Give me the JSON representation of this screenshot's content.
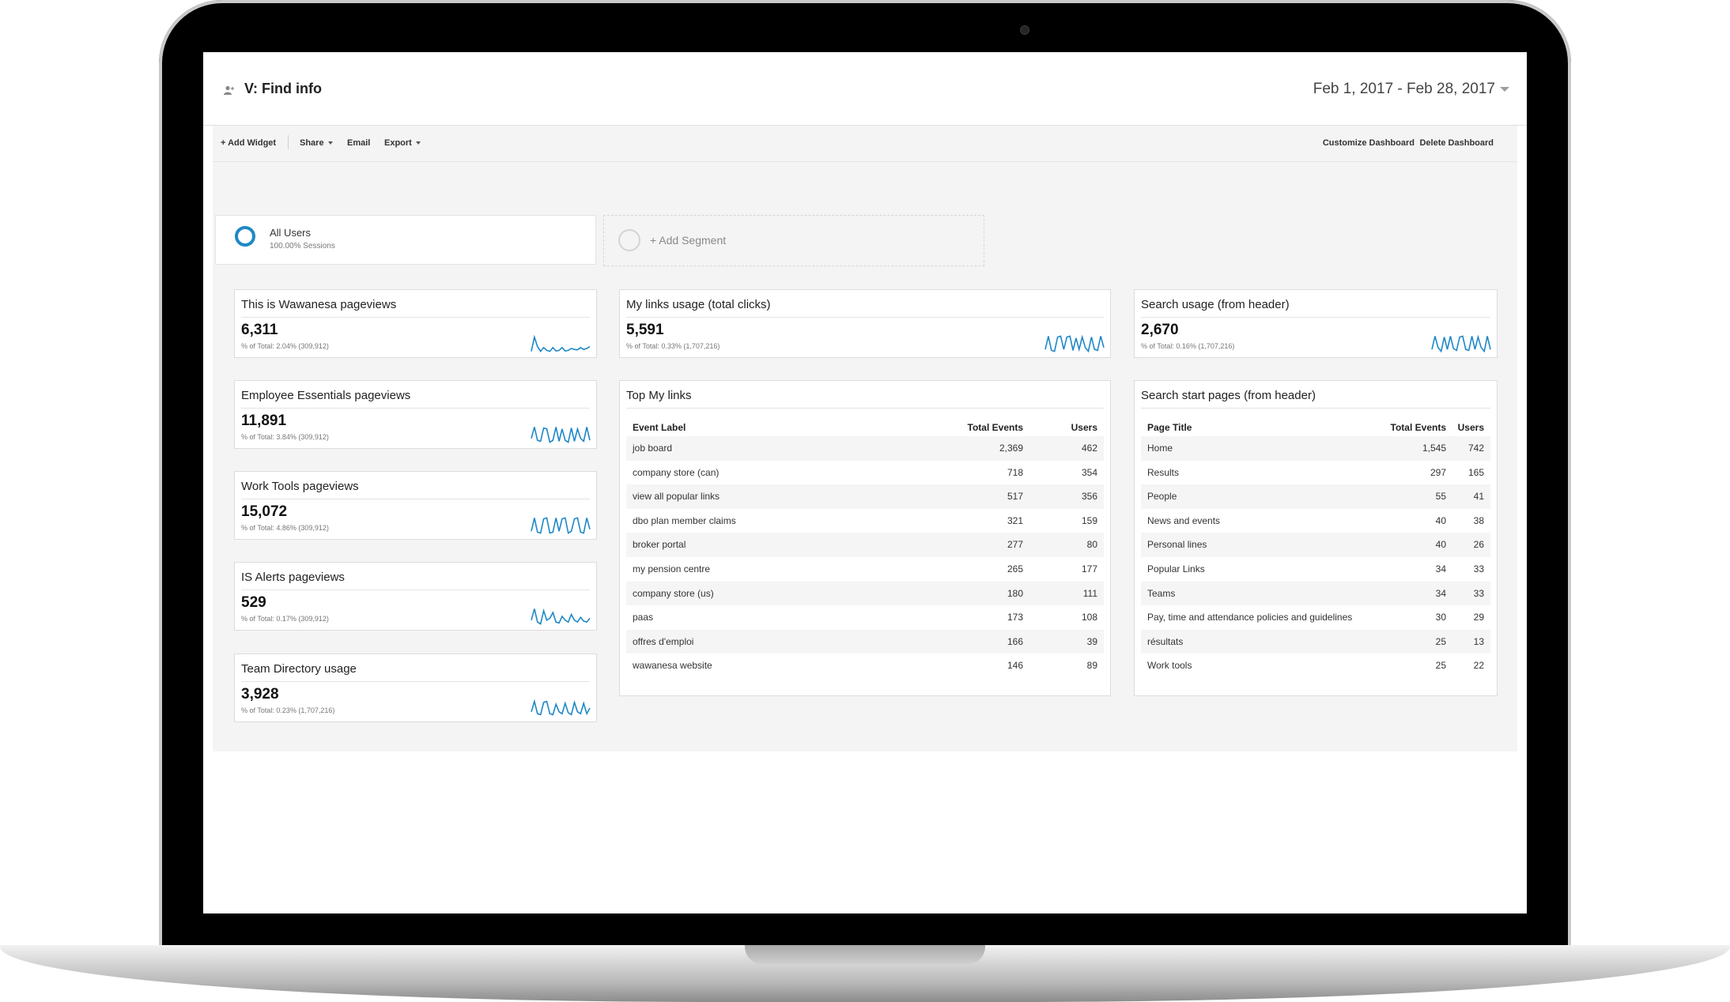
{
  "dashboard": {
    "title": "V: Find info",
    "date_range": "Feb 1, 2017 - Feb 28, 2017"
  },
  "toolbar": {
    "add_widget": "+ Add Widget",
    "share": "Share",
    "email": "Email",
    "export": "Export",
    "customize": "Customize Dashboard",
    "delete": "Delete Dashboard"
  },
  "segment": {
    "name": "All Users",
    "sessions": "100.00% Sessions",
    "add_label": "+ Add Segment"
  },
  "colors": {
    "accent": "#1e88c7",
    "spark": "#1e88c7"
  },
  "scorecards": [
    {
      "title": "This is Wawanesa pageviews",
      "value": "6,311",
      "sub": "% of Total: 2.04% (309,912)",
      "trend": [
        0.1,
        0.85,
        0.35,
        0.1,
        0.3,
        0.15,
        0.1,
        0.3,
        0.12,
        0.15,
        0.3,
        0.12,
        0.15,
        0.25,
        0.2,
        0.18,
        0.3,
        0.2,
        0.25,
        0.35
      ]
    },
    {
      "title": "Employee Essentials pageviews",
      "value": "11,891",
      "sub": "% of Total: 3.84% (309,912)",
      "trend": [
        0.3,
        0.9,
        0.2,
        0.15,
        0.85,
        0.8,
        0.1,
        0.2,
        0.9,
        0.15,
        0.8,
        0.2,
        0.1,
        0.85,
        0.15,
        0.8,
        0.3,
        0.15,
        0.9,
        0.2
      ]
    },
    {
      "title": "Work Tools pageviews",
      "value": "15,072",
      "sub": "% of Total: 4.86% (309,912)",
      "trend": [
        0.2,
        0.9,
        0.15,
        0.1,
        0.85,
        0.9,
        0.1,
        0.15,
        0.9,
        0.2,
        0.85,
        0.9,
        0.1,
        0.2,
        0.85,
        0.9,
        0.15,
        0.1,
        0.9,
        0.3
      ]
    },
    {
      "title": "IS Alerts pageviews",
      "value": "529",
      "sub": "% of Total: 0.17% (309,912)",
      "trend": [
        0.3,
        0.9,
        0.2,
        0.1,
        0.8,
        0.3,
        0.4,
        0.7,
        0.2,
        0.15,
        0.5,
        0.3,
        0.2,
        0.6,
        0.3,
        0.2,
        0.45,
        0.25,
        0.2,
        0.4
      ]
    },
    {
      "title": "Team Directory usage",
      "value": "3,928",
      "sub": "% of Total: 0.23% (1,707,216)",
      "trend": [
        0.3,
        0.85,
        0.2,
        0.15,
        0.8,
        0.85,
        0.2,
        0.15,
        0.7,
        0.3,
        0.2,
        0.75,
        0.25,
        0.15,
        0.8,
        0.3,
        0.2,
        0.75,
        0.2,
        0.5
      ]
    },
    {
      "title": "My links usage (total clicks)",
      "value": "5,591",
      "sub": "% of Total: 0.33% (1,707,216)",
      "trend": [
        0.2,
        0.9,
        0.15,
        0.1,
        0.85,
        0.9,
        0.2,
        0.85,
        0.9,
        0.15,
        0.8,
        0.2,
        0.85,
        0.3,
        0.1,
        0.85,
        0.2,
        0.15,
        0.9,
        0.3
      ]
    },
    {
      "title": "Search usage (from header)",
      "value": "2,670",
      "sub": "% of Total: 0.16% (1,707,216)",
      "trend": [
        0.2,
        0.9,
        0.3,
        0.1,
        0.85,
        0.2,
        0.9,
        0.25,
        0.15,
        0.85,
        0.9,
        0.2,
        0.15,
        0.9,
        0.2,
        0.85,
        0.3,
        0.1,
        0.9,
        0.2
      ]
    }
  ],
  "top_links": {
    "title": "Top My links",
    "columns": [
      "Event Label",
      "Total Events",
      "Users"
    ],
    "rows": [
      [
        "job board",
        "2,369",
        "462"
      ],
      [
        "company store (can)",
        "718",
        "354"
      ],
      [
        "view all popular links",
        "517",
        "356"
      ],
      [
        "dbo plan member claims",
        "321",
        "159"
      ],
      [
        "broker portal",
        "277",
        "80"
      ],
      [
        "my pension centre",
        "265",
        "177"
      ],
      [
        "company store (us)",
        "180",
        "111"
      ],
      [
        "paas",
        "173",
        "108"
      ],
      [
        "offres d'emploi",
        "166",
        "39"
      ],
      [
        "wawanesa website",
        "146",
        "89"
      ]
    ]
  },
  "search_pages": {
    "title": "Search start pages (from header)",
    "columns": [
      "Page Title",
      "Total Events",
      "Users"
    ],
    "rows": [
      [
        "Home",
        "1,545",
        "742"
      ],
      [
        "Results",
        "297",
        "165"
      ],
      [
        "People",
        "55",
        "41"
      ],
      [
        "News and events",
        "40",
        "38"
      ],
      [
        "Personal lines",
        "40",
        "26"
      ],
      [
        "Popular Links",
        "34",
        "33"
      ],
      [
        "Teams",
        "34",
        "33"
      ],
      [
        "Pay, time and attendance policies and guidelines",
        "30",
        "29"
      ],
      [
        "résultats",
        "25",
        "13"
      ],
      [
        "Work tools",
        "25",
        "22"
      ]
    ]
  }
}
